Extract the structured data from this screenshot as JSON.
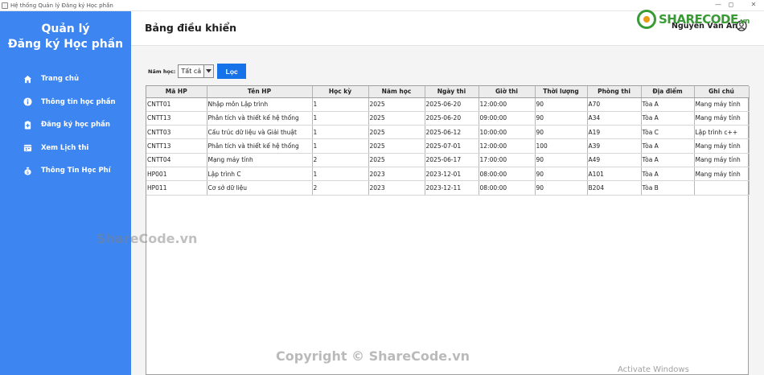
{
  "window": {
    "title": "Hệ thống Quản lý Đăng ký Học phần"
  },
  "sidebar": {
    "brand_line1": "Quản lý",
    "brand_line2": "Đăng ký Học phần",
    "items": [
      {
        "label": "Trang chủ",
        "icon": "home-icon"
      },
      {
        "label": "Thông tin học phần",
        "icon": "info-icon"
      },
      {
        "label": "Đăng ký học phần",
        "icon": "register-icon"
      },
      {
        "label": "Xem Lịch thi",
        "icon": "calendar-icon"
      },
      {
        "label": "Thông Tin Học Phí",
        "icon": "money-bag-icon"
      }
    ]
  },
  "header": {
    "title": "Bảng điều khiển",
    "user_name": "Nguyễn Văn An"
  },
  "filter": {
    "label": "Năm học:",
    "selected": "Tất cả",
    "button": "Lọc"
  },
  "table": {
    "columns": [
      "Mã HP",
      "Tên HP",
      "Học kỳ",
      "Năm học",
      "Ngày thi",
      "Giờ thi",
      "Thời lượng",
      "Phòng thi",
      "Địa điểm",
      "Ghi chú"
    ],
    "rows": [
      [
        "CNTT01",
        "Nhập môn Lập trình",
        "1",
        "2025",
        "2025-06-20",
        "12:00:00",
        "90",
        "A70",
        "Tòa A",
        "Mang máy tính"
      ],
      [
        "CNTT13",
        "Phân tích và thiết kế hệ thống",
        "1",
        "2025",
        "2025-06-20",
        "09:00:00",
        "90",
        "A34",
        "Tòa A",
        "Mang máy tính"
      ],
      [
        "CNTT03",
        "Cấu trúc dữ liệu và Giải thuật",
        "1",
        "2025",
        "2025-06-12",
        "10:00:00",
        "90",
        "A19",
        "Tòa C",
        "Lập trình c++"
      ],
      [
        "CNTT13",
        "Phân tích và thiết kế hệ thống",
        "1",
        "2025",
        "2025-07-01",
        "12:00:00",
        "100",
        "A39",
        "Tòa A",
        "Mang máy tính"
      ],
      [
        "CNTT04",
        "Mạng máy tính",
        "2",
        "2025",
        "2025-06-17",
        "17:00:00",
        "90",
        "A49",
        "Tòa A",
        "Mang máy tính"
      ],
      [
        "HP001",
        "Lập trình C",
        "1",
        "2023",
        "2023-12-01",
        "08:00:00",
        "90",
        "A101",
        "Tòa A",
        "Mang máy tính"
      ],
      [
        "HP011",
        "Cơ sở dữ liệu",
        "2",
        "2023",
        "2023-12-11",
        "08:00:00",
        "90",
        "B204",
        "Tòa B",
        ""
      ]
    ]
  },
  "watermarks": {
    "logo_main": "SHARECODE",
    "logo_suffix": ".vn",
    "mid": "ShareCode.vn",
    "bottom": "Copyright © ShareCode.vn",
    "activate": "Activate Windows"
  },
  "colors": {
    "sidebar": "#3d85f1",
    "button": "#1672e8",
    "logo": "#3a9a36"
  }
}
